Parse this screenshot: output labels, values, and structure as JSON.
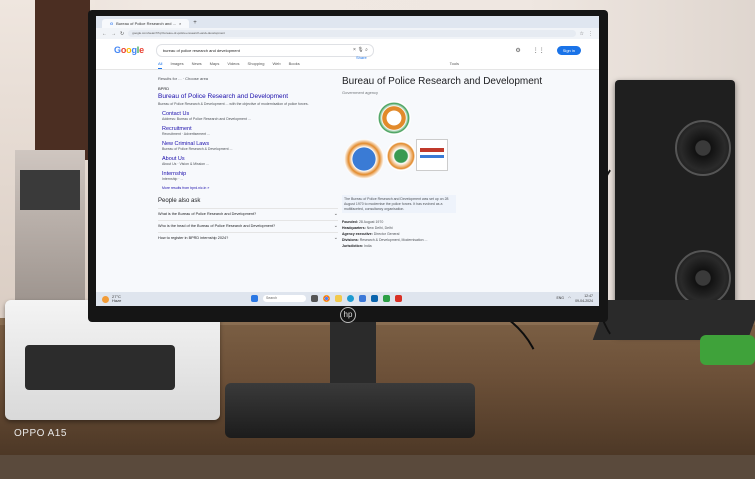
{
  "browser": {
    "tab_title": "Bureau of Police Research and ...",
    "new_tab": "+",
    "url": "google.com/search?q=bureau+of+police+research+and+development"
  },
  "google": {
    "search_query": "bureau of police research and development",
    "sign_in": "Sign in",
    "tabs": [
      "All",
      "Images",
      "News",
      "Maps",
      "Videos",
      "Shopping",
      "Web",
      "Books"
    ],
    "tools": "Tools"
  },
  "results": {
    "meta": "Results for ... · Choose area",
    "source": "BPRD",
    "title": "Bureau of Police Research and Development",
    "snippet": "Bureau of Police Research & Development ... with the objective of modernisation of police forces.",
    "sitelinks": [
      {
        "title": "Contact Us",
        "desc": "Address: Bureau of Police Research and Development ..."
      },
      {
        "title": "Recruitment",
        "desc": "Recruitment · Advertisement ..."
      },
      {
        "title": "New Criminal Laws",
        "desc": "Bureau of Police Research & Development ..."
      },
      {
        "title": "About Us",
        "desc": "About Us · Vision & Mission ..."
      },
      {
        "title": "Internship",
        "desc": "Internship · ..."
      }
    ],
    "more": "More results from bprd.nic.in »",
    "paa_title": "People also ask",
    "paa": [
      "What is the Bureau of Police Research and Development?",
      "Who is the head of the Bureau of Police Research and Development?",
      "How to register in BPRD internship 2024?"
    ]
  },
  "knowledge_panel": {
    "share": "Share",
    "title": "Bureau of Police Research and Development",
    "subtitle": "Government agency",
    "description": "The Bureau of Police Research and Development was set up on 28 August 1970 to modernise the police forces. It has evolved as a multifaceted, consultancy organisation.",
    "facts": [
      {
        "k": "Founded:",
        "v": "28 August 1970"
      },
      {
        "k": "Headquarters:",
        "v": "New Delhi, Delhi"
      },
      {
        "k": "Agency executive:",
        "v": "Director General"
      },
      {
        "k": "Divisions:",
        "v": "Research & Development, Modernisation ..."
      },
      {
        "k": "Jurisdiction:",
        "v": "India"
      }
    ],
    "colors": {
      "emblem_orange": "#e28a2b",
      "emblem_blue": "#3a7bd5",
      "emblem_green": "#3a9a52"
    }
  },
  "taskbar": {
    "weather_temp": "27°C",
    "weather_desc": "Haze",
    "search_placeholder": "Search",
    "time": "12:47",
    "date": "09-04-2024",
    "lang": "ENG"
  },
  "monitor_brand": "hp",
  "photo_watermark": "OPPO A15"
}
